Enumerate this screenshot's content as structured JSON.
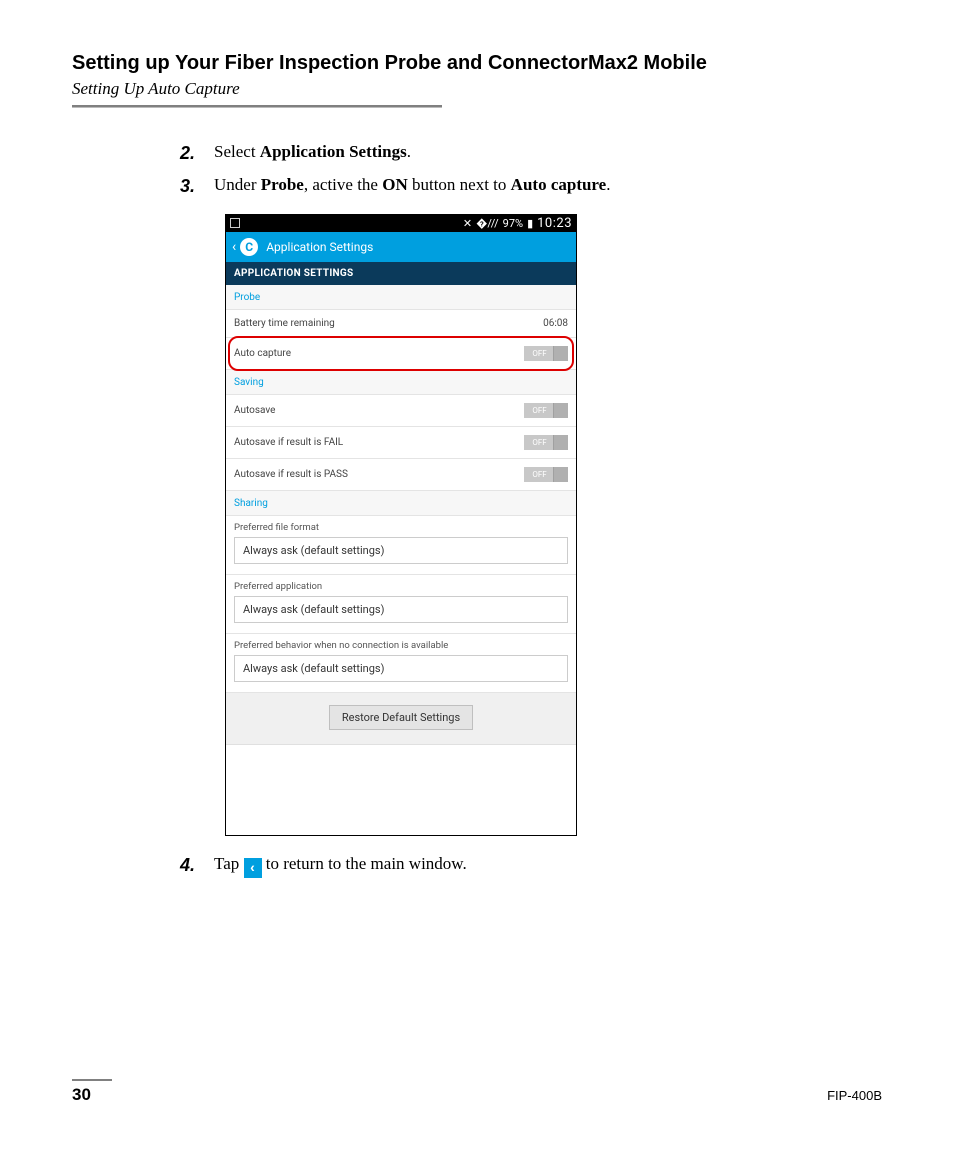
{
  "header": {
    "title": "Setting up Your Fiber Inspection Probe and ConnectorMax2 Mobile",
    "subtitle": "Setting Up Auto Capture"
  },
  "steps": {
    "s2_num": "2.",
    "s2_a": "Select ",
    "s2_b": "Application Settings",
    "s2_c": ".",
    "s3_num": "3.",
    "s3_a": "Under ",
    "s3_b": "Probe",
    "s3_c": ", active the ",
    "s3_d": "ON",
    "s3_e": " button next to ",
    "s3_f": "Auto capture",
    "s3_g": ".",
    "s4_num": "4.",
    "s4_a": "Tap ",
    "s4_b": " to return to the main window."
  },
  "phone": {
    "statusbar": {
      "battery_pct": "97%",
      "clock": "10:23"
    },
    "appbar": {
      "logo_letter": "C",
      "title": "Application Settings"
    },
    "section_title": "APPLICATION SETTINGS",
    "probe": {
      "label": "Probe",
      "battery_label": "Battery time remaining",
      "battery_value": "06:08",
      "autocapture_label": "Auto capture",
      "autocapture_state": "OFF"
    },
    "saving": {
      "label": "Saving",
      "autosave_label": "Autosave",
      "autosave_state": "OFF",
      "fail_label": "Autosave if result is FAIL",
      "fail_state": "OFF",
      "pass_label": "Autosave if result is PASS",
      "pass_state": "OFF"
    },
    "sharing": {
      "label": "Sharing",
      "file_format_label": "Preferred file format",
      "file_format_value": "Always ask (default settings)",
      "app_label": "Preferred application",
      "app_value": "Always ask (default settings)",
      "noconn_label": "Preferred behavior when no connection is available",
      "noconn_value": "Always ask (default settings)"
    },
    "restore_label": "Restore Default Settings"
  },
  "footer": {
    "page": "30",
    "model": "FIP-400B"
  }
}
